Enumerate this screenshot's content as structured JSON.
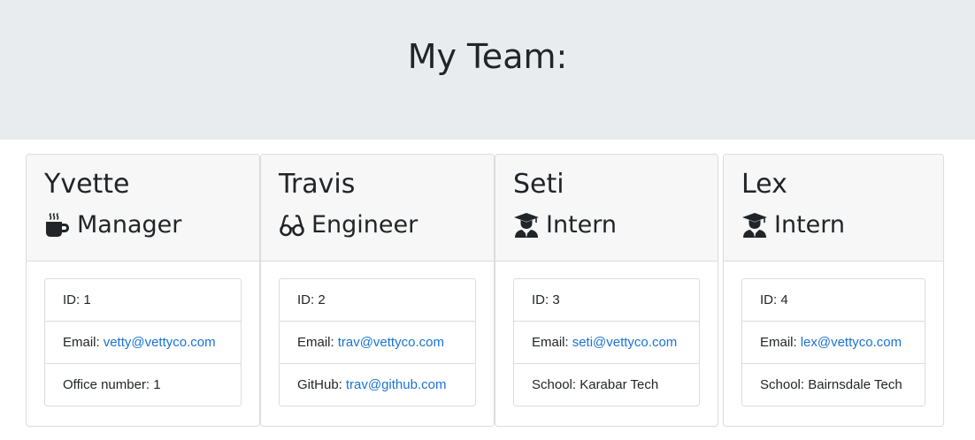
{
  "header": {
    "title": "My Team:"
  },
  "team": [
    {
      "name": "Yvette",
      "role": "Manager",
      "icon": "mug-icon",
      "id_label": "ID:",
      "id": "1",
      "email_label": "Email:",
      "email": "vetty@vettyco.com",
      "extra_label": "Office number:",
      "extra": "1"
    },
    {
      "name": "Travis",
      "role": "Engineer",
      "icon": "glasses-icon",
      "id_label": "ID:",
      "id": "2",
      "email_label": "Email:",
      "email": "trav@vettyco.com",
      "extra_label": "GitHub:",
      "extra": "trav@github.com"
    },
    {
      "name": "Seti",
      "role": "Intern",
      "icon": "graduate-icon",
      "id_label": "ID:",
      "id": "3",
      "email_label": "Email:",
      "email": "seti@vettyco.com",
      "extra_label": "School:",
      "extra": "Karabar Tech"
    },
    {
      "name": "Lex",
      "role": "Intern",
      "icon": "graduate-icon",
      "id_label": "ID:",
      "id": "4",
      "email_label": "Email:",
      "email": "lex@vettyco.com",
      "extra_label": "School:",
      "extra": "Bairnsdale Tech"
    }
  ],
  "colors": {
    "link": "#1a73d6",
    "header_bg": "#e9ecef",
    "card_header_bg": "#f7f7f7"
  }
}
